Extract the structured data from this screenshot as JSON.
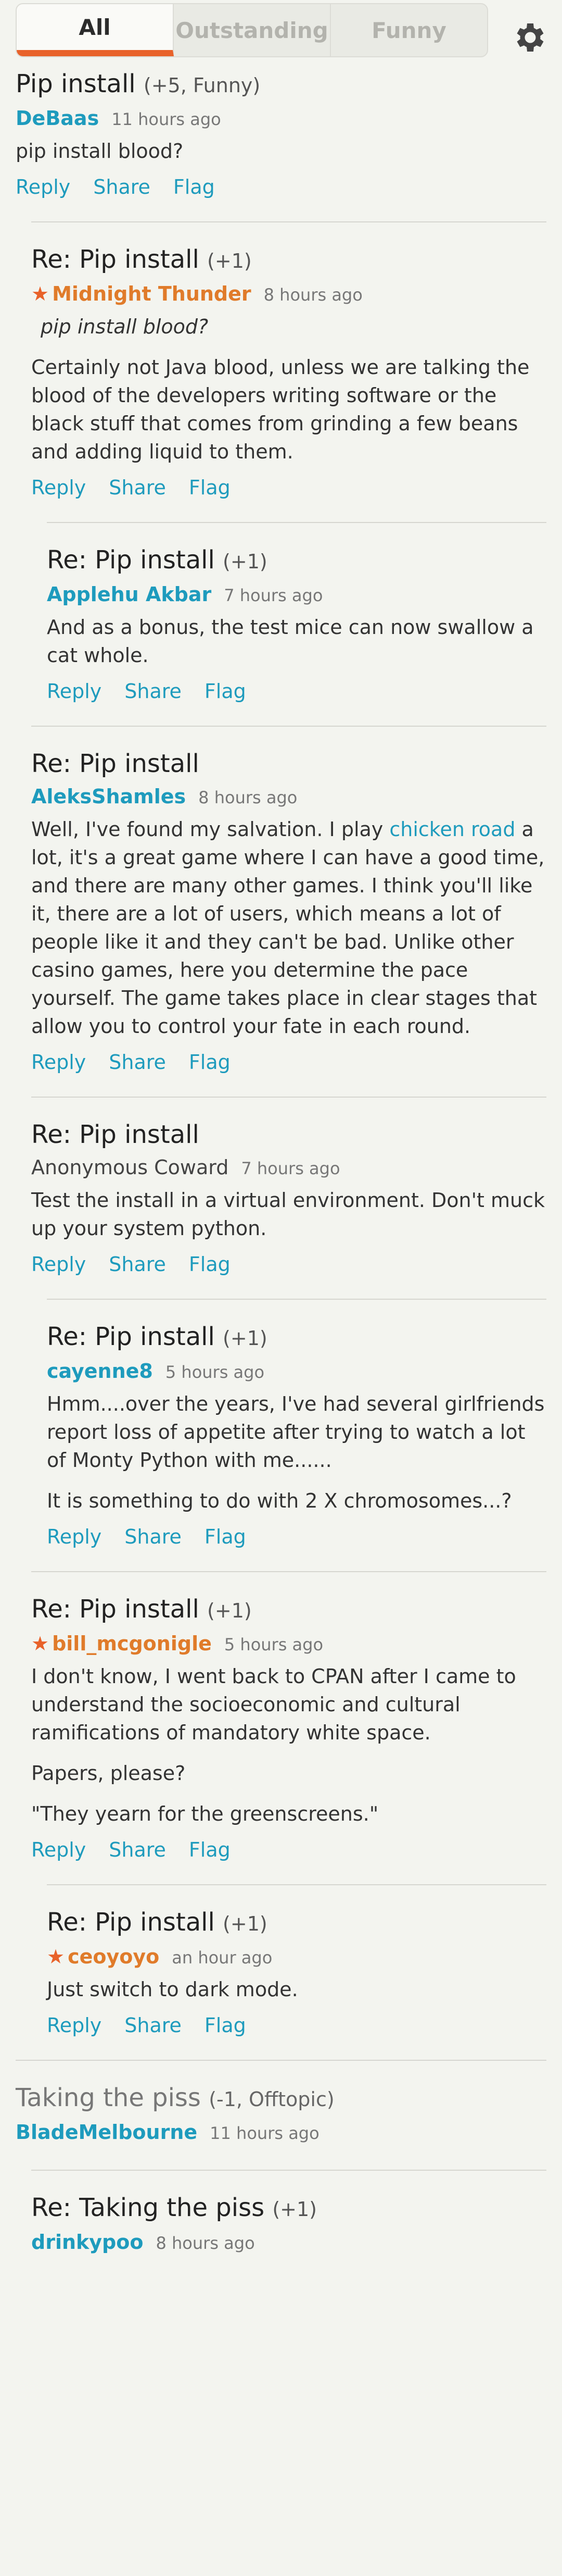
{
  "tabs": [
    "All",
    "Outstanding",
    "Funny"
  ],
  "actions": {
    "reply": "Reply",
    "share": "Share",
    "flag": "Flag"
  },
  "comments": [
    {
      "title": "Pip install",
      "score": "(+5, Funny)",
      "author": "DeBaas",
      "time": "11 hours ago",
      "body": [
        "pip install blood?"
      ]
    },
    {
      "title": "Re: Pip install",
      "score": "(+1)",
      "author": "Midnight Thunder",
      "time": "8 hours ago",
      "quote": "pip install blood?",
      "body": [
        "Certainly not Java blood, unless we are talking the blood of the developers writing software or the black stuff that comes from grinding a few beans and adding liquid to them."
      ]
    },
    {
      "title": "Re: Pip install",
      "score": "(+1)",
      "author": "Applehu Akbar",
      "time": "7 hours ago",
      "body": [
        "And as a bonus, the test mice can now swallow a cat whole."
      ]
    },
    {
      "title": "Re: Pip install",
      "score": "",
      "author": "AleksShamles",
      "time": "8 hours ago",
      "body_before": "Well, I've found my salvation. I play ",
      "link": "chicken road",
      "body_after": " a lot, it's a great game where I can have a good time, and there are many other games. I think you'll like it, there are a lot of users, which means a lot of people like it and they can't be bad. Unlike other casino games, here you determine the pace yourself. The game takes place in clear stages that allow you to control your fate in each round."
    },
    {
      "title": "Re: Pip install",
      "score": "",
      "author": "Anonymous Coward",
      "time": "7 hours ago",
      "body": [
        "Test the install in a virtual environment. Don't muck up your system python."
      ]
    },
    {
      "title": "Re: Pip install",
      "score": "(+1)",
      "author": "cayenne8",
      "time": "5 hours ago",
      "body": [
        "Hmm....over the years, I've had several girlfriends report loss of appetite after trying to watch a lot of Monty Python with me......",
        "It is something to do with 2 X chromosomes...?"
      ]
    },
    {
      "title": "Re: Pip install",
      "score": "(+1)",
      "author": "bill_mcgonigle",
      "time": "5 hours ago",
      "body": [
        "I don't know, I went back to CPAN after I came to understand the socioeconomic and cultural ramifications of mandatory white space.",
        "Papers, please?",
        "\"They yearn for the greenscreens.\""
      ]
    },
    {
      "title": "Re: Pip install",
      "score": "(+1)",
      "author": "ceoyoyo",
      "time": "an hour ago",
      "body": [
        "Just switch to dark mode."
      ]
    },
    {
      "title": "Taking the piss",
      "score": "(-1, Offtopic)",
      "author": "BladeMelbourne",
      "time": "11 hours ago"
    },
    {
      "title": "Re: Taking the piss",
      "score": "(+1)",
      "author": "drinkypoo",
      "time": "8 hours ago"
    }
  ]
}
